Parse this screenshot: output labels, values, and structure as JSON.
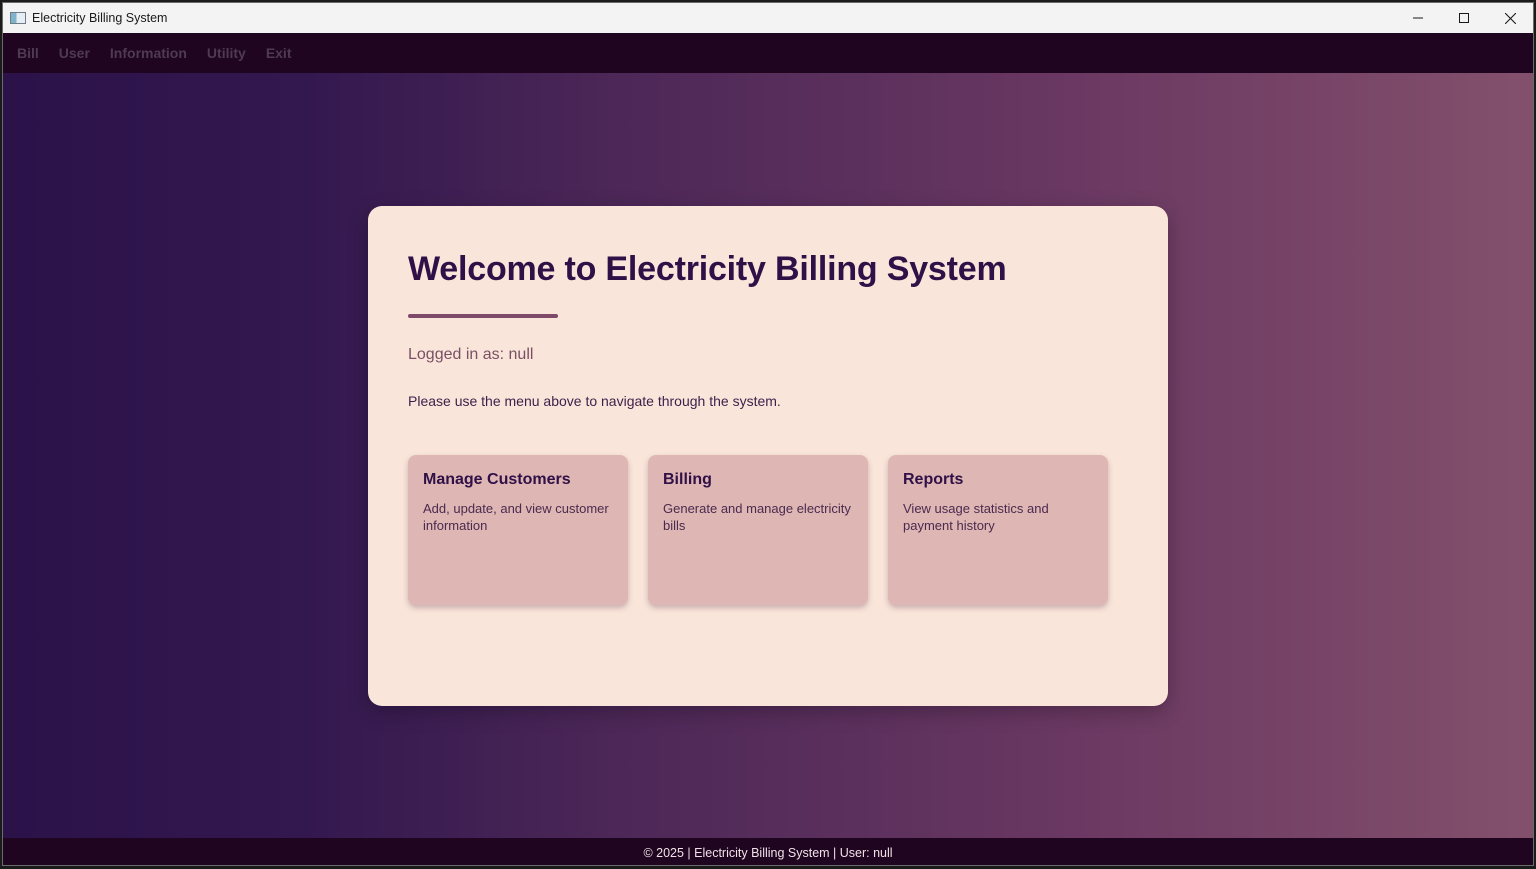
{
  "window": {
    "title": "Electricity Billing System",
    "controls": [
      "minimize",
      "maximize",
      "close"
    ]
  },
  "menu": {
    "items": [
      "Bill",
      "User",
      "Information",
      "Utility",
      "Exit"
    ]
  },
  "welcome": {
    "heading": "Welcome to Electricity Billing System",
    "logged_in": "Logged in as: null",
    "instruction": "Please use the menu above to navigate through the system."
  },
  "tiles": [
    {
      "title": "Manage Customers",
      "description": "Add, update, and view customer information"
    },
    {
      "title": "Billing",
      "description": "Generate and manage electricity bills"
    },
    {
      "title": "Reports",
      "description": "View usage statistics and payment history"
    }
  ],
  "status": {
    "text": "© 2025 | Electricity Billing System | User: null"
  },
  "colors": {
    "menubar_bg": "#1f0520",
    "card_bg": "#fae5da",
    "tile_bg": "#deb6b3",
    "heading": "#2f1047",
    "accent": "#7f4a6a"
  }
}
